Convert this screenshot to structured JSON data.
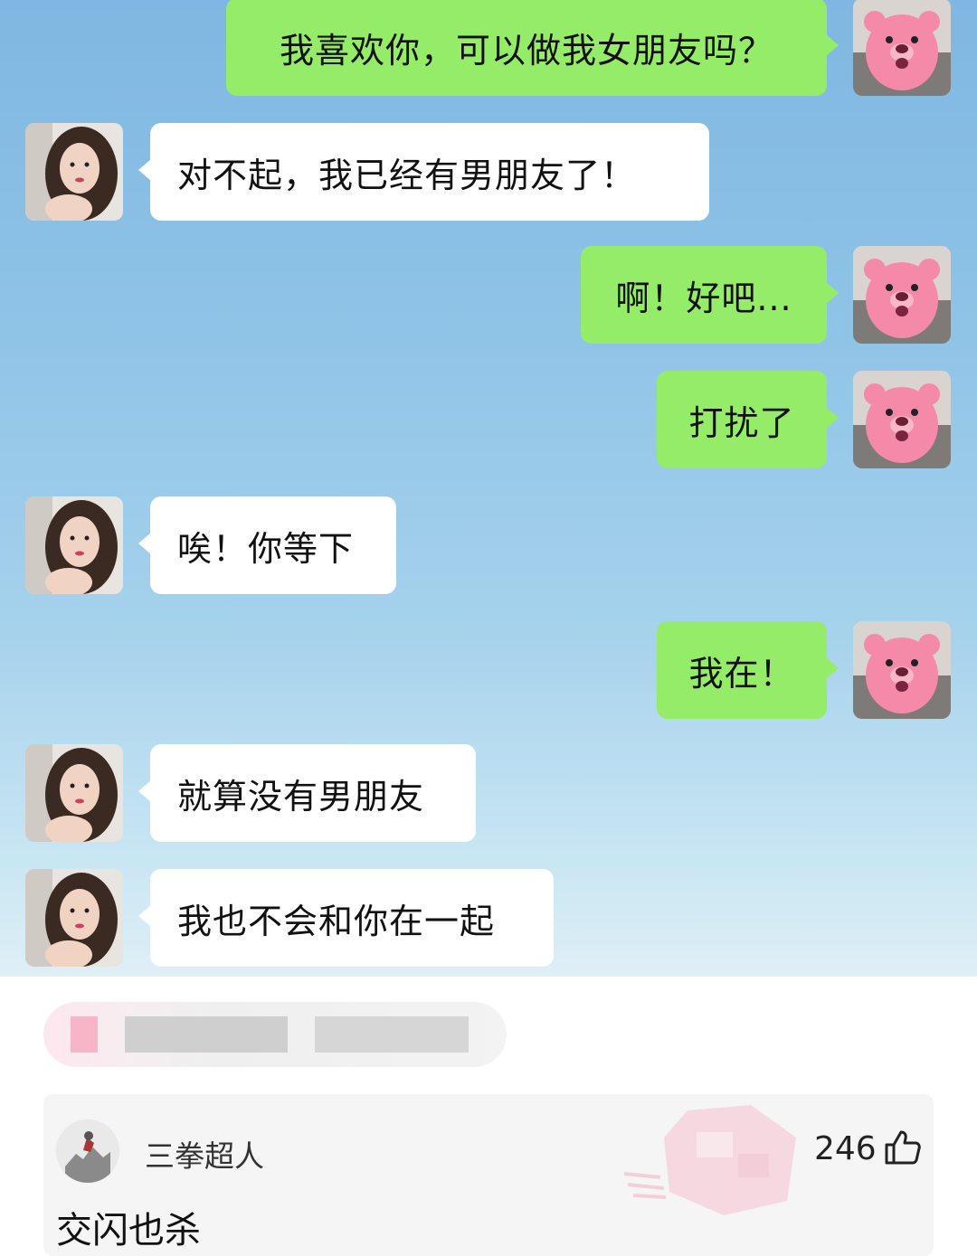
{
  "chat": {
    "messages": [
      {
        "from": "me",
        "text": "我喜欢你，可以做我女朋友吗？"
      },
      {
        "from": "her",
        "text": "对不起，我已经有男朋友了！"
      },
      {
        "from": "me",
        "text": "啊！好吧..."
      },
      {
        "from": "me",
        "text": "打扰了"
      },
      {
        "from": "her",
        "text": "唉！你等下"
      },
      {
        "from": "me",
        "text": "我在！"
      },
      {
        "from": "her",
        "text": "就算没有男朋友"
      },
      {
        "from": "her",
        "text": "我也不会和你在一起"
      }
    ],
    "colors": {
      "my_bubble": "#95ec69",
      "her_bubble": "#ffffff"
    }
  },
  "comment": {
    "author": "三拳超人",
    "likes": "246",
    "text": "交闪也杀",
    "like_icon": "thumbs-up-icon"
  }
}
